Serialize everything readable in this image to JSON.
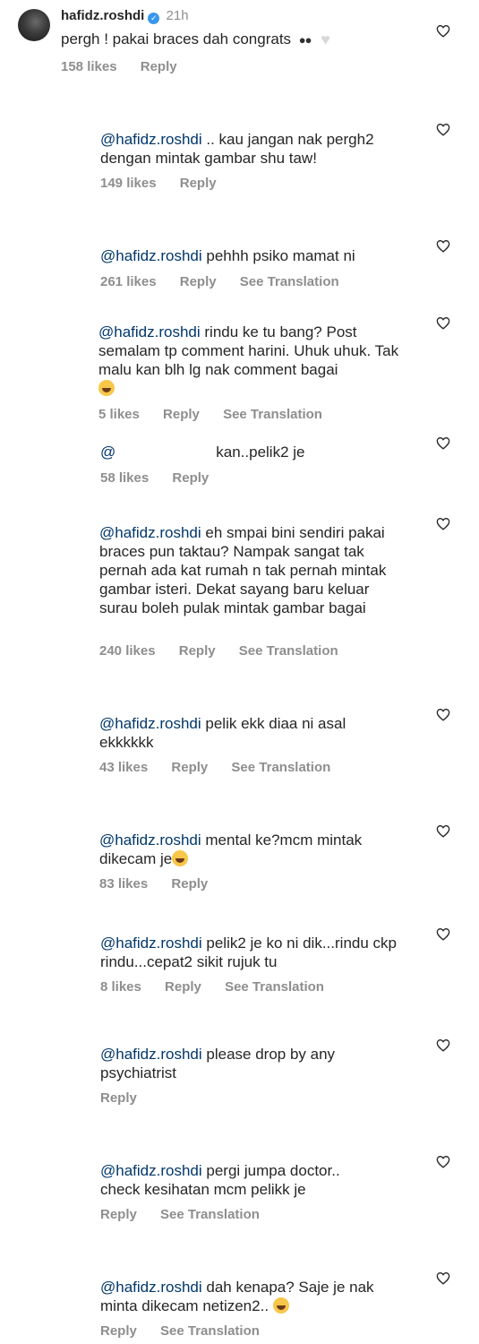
{
  "top_comment": {
    "username": "hafidz.roshdi",
    "time": "21h",
    "text": "pergh ! pakai braces dah congrats",
    "likes": "158 likes",
    "reply_label": "Reply"
  },
  "replies": [
    {
      "mention": "@hafidz.roshdi",
      "text": " .. kau jangan nak pergh2 dengan mintak gambar shu taw!",
      "likes": "149 likes",
      "reply_label": "Reply",
      "translation": ""
    },
    {
      "mention": "@hafidz.roshdi",
      "text": " pehhh psiko mamat ni",
      "likes": "261 likes",
      "reply_label": "Reply",
      "translation": "See Translation"
    },
    {
      "mention": "@hafidz.roshdi",
      "text": " rindu ke tu bang? Post semalam tp comment harini. Uhuk uhuk. Tak malu kan blh lg nak comment bagai",
      "likes": "5 likes",
      "reply_label": "Reply",
      "translation": "See Translation"
    },
    {
      "mention": "@",
      "text": "kan..pelik2 je",
      "likes": "58 likes",
      "reply_label": "Reply",
      "translation": ""
    },
    {
      "mention": "@hafidz.roshdi",
      "text": " eh smpai bini sendiri pakai braces pun taktau? Nampak sangat tak pernah ada kat rumah n tak pernah mintak gambar isteri. Dekat sayang baru keluar surau boleh pulak mintak gambar bagai",
      "likes": "240 likes",
      "reply_label": "Reply",
      "translation": "See Translation"
    },
    {
      "mention": "@hafidz.roshdi",
      "text": " pelik ekk diaa ni asal ekkkkkk",
      "likes": "43 likes",
      "reply_label": "Reply",
      "translation": "See Translation"
    },
    {
      "mention": "@hafidz.roshdi",
      "text": " mental ke?mcm mintak dikecam je",
      "likes": "83 likes",
      "reply_label": "Reply",
      "translation": ""
    },
    {
      "mention": "@hafidz.roshdi",
      "text": " pelik2 je ko ni dik...rindu ckp rindu...cepat2 sikit rujuk tu",
      "likes": "8 likes",
      "reply_label": "Reply",
      "translation": "See Translation"
    },
    {
      "mention": "@hafidz.roshdi",
      "text": " please drop by any psychiatrist",
      "likes": "",
      "reply_label": "Reply",
      "translation": ""
    },
    {
      "mention": "@hafidz.roshdi",
      "text": " pergi jumpa doctor.. check kesihatan mcm pelikk je",
      "likes": "",
      "reply_label": "Reply",
      "translation": "See Translation"
    },
    {
      "mention": "@hafidz.roshdi",
      "text": " dah kenapa? Saje je nak minta dikecam netizen2..",
      "likes": "",
      "reply_label": "Reply",
      "translation": "See Translation"
    }
  ],
  "colors": {
    "mention": "#00376b",
    "meta": "#8e8e8e",
    "verified": "#3897f0"
  },
  "icons": {
    "like": "heart-outline-icon",
    "verified": "verified-badge-icon",
    "avatar": "avatar"
  }
}
